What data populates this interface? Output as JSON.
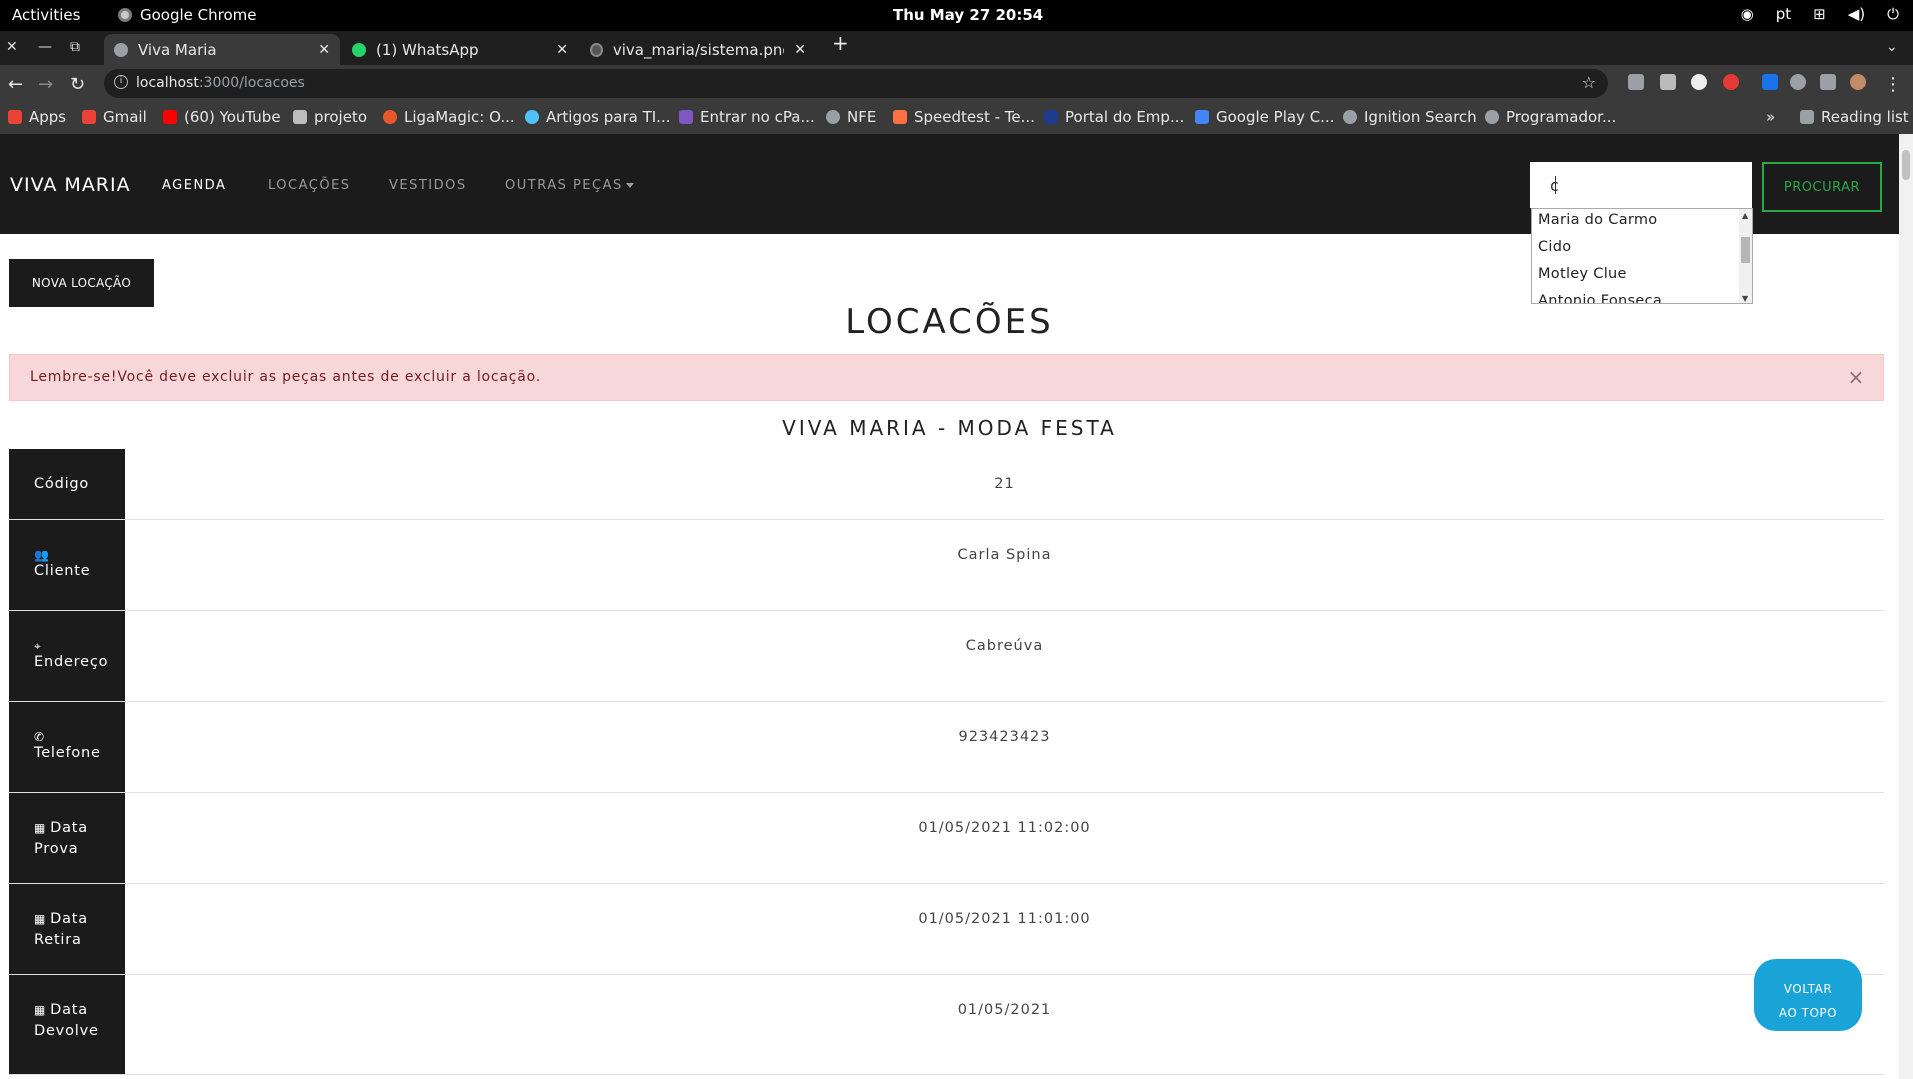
{
  "os": {
    "activities": "Activities",
    "app_name": "Google Chrome",
    "clock": "Thu May 27  20:54",
    "lang": "pt"
  },
  "tabs": [
    {
      "title": "Viva Maria"
    },
    {
      "title": "(1) WhatsApp"
    },
    {
      "title": "viva_maria/sistema.png a"
    }
  ],
  "address": {
    "host": "localhost",
    "path": ":3000/locacoes"
  },
  "bookmarks": [
    {
      "label": "Apps",
      "color": "#ea4335"
    },
    {
      "label": "Gmail",
      "color": "#ea4335"
    },
    {
      "label": "(60) YouTube",
      "color": "#ff0000"
    },
    {
      "label": "projeto",
      "color": "#bdbdbd"
    },
    {
      "label": "LigaMagic: O...",
      "color": "#e8572a"
    },
    {
      "label": "Artigos para TI...",
      "color": "#4fc3f7"
    },
    {
      "label": "Entrar no cPa...",
      "color": "#7e57c2"
    },
    {
      "label": "NFE",
      "color": "#9aa0a6"
    },
    {
      "label": "Speedtest - Te...",
      "color": "#ff7043"
    },
    {
      "label": "Portal do Emp...",
      "color": "#1e3a8a"
    },
    {
      "label": "Google Play C...",
      "color": "#4285f4"
    },
    {
      "label": "Ignition Search",
      "color": "#9aa0a6"
    },
    {
      "label": "Programador...",
      "color": "#9aa0a6"
    },
    {
      "label": "Reading list",
      "color": "#9aa0a6"
    }
  ],
  "site": {
    "brand": "VIVA MARIA",
    "nav": [
      {
        "label": "AGENDA"
      },
      {
        "label": "LOCAÇÕES"
      },
      {
        "label": "VESTIDOS"
      },
      {
        "label": "OUTRAS PEÇAS"
      }
    ],
    "search_value": "c",
    "search_button": "PROCURAR",
    "suggestions": [
      "Maria do Carmo",
      "Cido",
      "Motley Clue",
      "Antonio Fonseca"
    ],
    "new_button": "NOVA LOCAÇÃO",
    "page_title": "LOCACÕES",
    "alert": "Lembre-se!Você deve excluir as peças antes de excluir a locação.",
    "alert_close": "×",
    "subtitle": "VIVA MARIA - MODA FESTA",
    "to_top": [
      "VOLTAR",
      "AO TOPO"
    ]
  },
  "detail": [
    {
      "label": "Código",
      "icon": "",
      "value": "21"
    },
    {
      "label": "Cliente",
      "icon": "users-icon",
      "value": "Carla Spina"
    },
    {
      "label": "Endereço",
      "icon": "map-marker-icon",
      "value": "Cabreúva"
    },
    {
      "label": "Telefone",
      "icon": "phone-icon",
      "value": "923423423"
    },
    {
      "label": "Data Prova",
      "icon": "calendar-icon",
      "value": "01/05/2021 11:02:00"
    },
    {
      "label": "Data Retira",
      "icon": "calendar-icon",
      "value": "01/05/2021 11:01:00"
    },
    {
      "label": "Data Devolve",
      "icon": "calendar-icon",
      "value": "01/05/2021"
    }
  ]
}
